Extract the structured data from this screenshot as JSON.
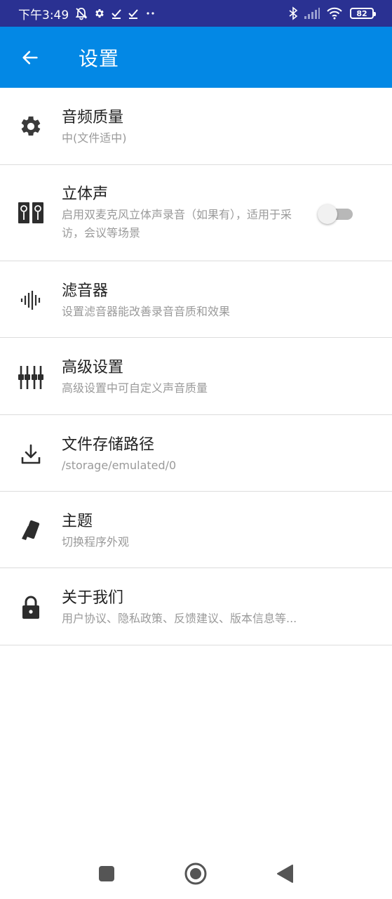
{
  "status_bar": {
    "time": "下午3:49",
    "battery": "82",
    "icons": [
      "alarm-off-icon",
      "gear-icon",
      "check-icon",
      "check-icon",
      "more-dots-icon",
      "bluetooth-icon",
      "signal-icon",
      "wifi-icon",
      "battery-icon"
    ]
  },
  "app_bar": {
    "title": "设置",
    "background": "#0388e5",
    "back_icon": "arrow-left-icon"
  },
  "settings": {
    "items": [
      {
        "icon": "gear-icon",
        "title": "音频质量",
        "subtitle": "中(文件适中)"
      },
      {
        "icon": "speakers-icon",
        "title": "立体声",
        "subtitle": "启用双麦克风立体声录音（如果有），适用于采访，会议等场景",
        "toggle": false
      },
      {
        "icon": "waveform-icon",
        "title": "滤音器",
        "subtitle": "设置滤音器能改善录音音质和效果"
      },
      {
        "icon": "equalizer-icon",
        "title": "高级设置",
        "subtitle": "高级设置中可自定义声音质量"
      },
      {
        "icon": "download-icon",
        "title": "文件存储路径",
        "subtitle": "/storage/emulated/0"
      },
      {
        "icon": "theme-cards-icon",
        "title": "主题",
        "subtitle": "切换程序外观"
      },
      {
        "icon": "lock-icon",
        "title": "关于我们",
        "subtitle": "用户协议、隐私政策、反馈建议、版本信息等..."
      }
    ]
  },
  "nav_bar": {
    "icons": [
      "recent-apps-icon",
      "home-icon",
      "back-triangle-icon"
    ]
  },
  "colors": {
    "status_bar": "#2a3192",
    "accent": "#0388e5",
    "title_text": "#222222",
    "subtitle_text": "#9a9a9a",
    "divider": "#dcdcdc"
  }
}
